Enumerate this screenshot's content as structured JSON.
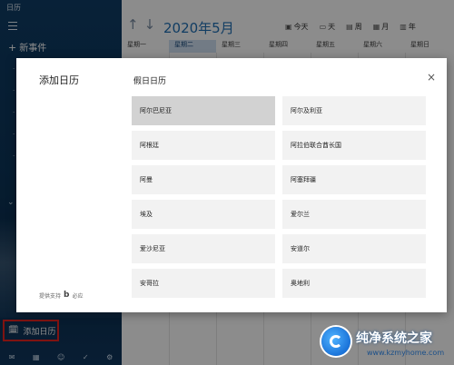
{
  "sidebar": {
    "app_title": "日历",
    "new_event": "新事件",
    "add_calendar": "添加日历"
  },
  "main": {
    "month_title": "2020年5月",
    "views": [
      "今天",
      "天",
      "周",
      "月",
      "年"
    ],
    "weekdays": [
      "星期一",
      "星期二",
      "星期三",
      "星期四",
      "星期五",
      "星期六",
      "星期日"
    ],
    "active_weekday_index": 1
  },
  "dialog": {
    "left_title": "添加日历",
    "right_title": "假日日历",
    "footer_text": "提供支持",
    "footer_brand": "必应",
    "holidays": [
      {
        "label": "阿尔巴尼亚",
        "selected": true
      },
      {
        "label": "阿尔及利亚",
        "selected": false
      },
      {
        "label": "阿根廷",
        "selected": false
      },
      {
        "label": "阿拉伯联合酋长国",
        "selected": false
      },
      {
        "label": "阿曼",
        "selected": false
      },
      {
        "label": "阿塞拜疆",
        "selected": false
      },
      {
        "label": "埃及",
        "selected": false
      },
      {
        "label": "爱尔兰",
        "selected": false
      },
      {
        "label": "爱沙尼亚",
        "selected": false
      },
      {
        "label": "安道尔",
        "selected": false
      },
      {
        "label": "安哥拉",
        "selected": false
      },
      {
        "label": "奥地利",
        "selected": false
      }
    ]
  },
  "watermark": {
    "title": "纯净系统之家",
    "url": "www.kzmyhome.com"
  },
  "colors": {
    "sidebar": "#0f3d66",
    "accent": "#1f6fb5",
    "highlight_box": "#e8231f",
    "selected_item": "#d2d2d2"
  }
}
